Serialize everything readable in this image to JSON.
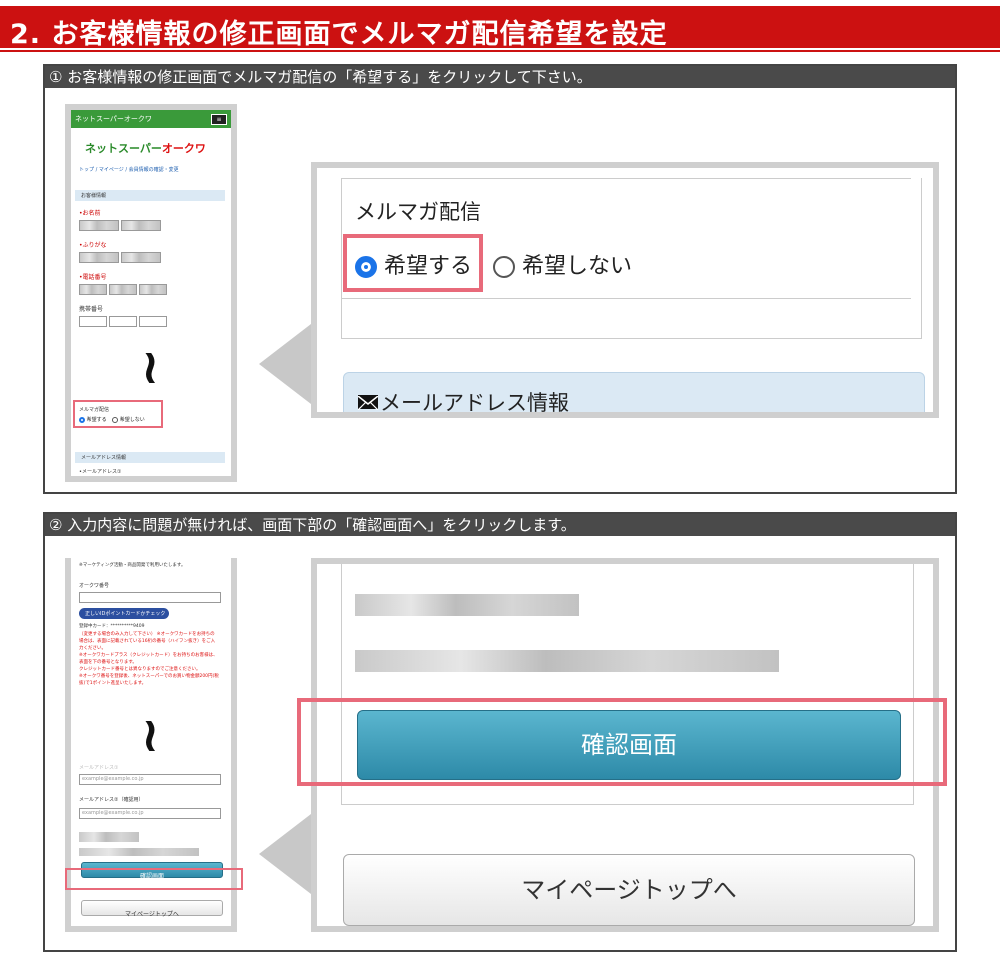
{
  "title": "2. お客様情報の修正画面でメルマガ配信希望を設定",
  "step1": {
    "instruction": "① お客様情報の修正画面でメルマガ配信の「希望する」をクリックして下さい。",
    "phone": {
      "header_title": "ネットスーパーオークワ",
      "logo_part1": "ネットスーパー",
      "logo_part2": "オークワ",
      "breadcrumb": "トップ / マイページ / 会員情報の確認・変更",
      "section_customer": "お客様情報",
      "label_name": "•お名前",
      "label_kana": "•ふりがな",
      "label_phone": "•電話番号",
      "label_mobile": "携帯番号",
      "label_mailmag": "メルマガ配信",
      "opt_yes": "希望する",
      "opt_no": "希望しない",
      "section_mail": "メールアドレス情報",
      "label_mail1": "•メールアドレス①",
      "squiggle": "~"
    },
    "zoom": {
      "label_mailmag": "メルマガ配信",
      "opt_yes": "希望する",
      "opt_no": "希望しない",
      "section_mail": "メールアドレス情報"
    }
  },
  "step2": {
    "instruction": "② 入力内容に問題が無ければ、画面下部の「確認画面へ」をクリックします。",
    "phone": {
      "top_note": "※マーケティング活動・商品開発で利用いたします。",
      "label_card": "オークワ番号",
      "card_button": "正しいIDポイントカードかチェック",
      "registered_card": "登録中カード：**********9409",
      "notes": [
        "（変更する場合のみ入力して下さい） ※オークワカードをお持ちの場合は、表面に記載されている16桁の番号（ハイフン抜き）をご入力ください。",
        "※オークワカードプラス（クレジットカード）をお持ちのお客様は、表面を下の番号となります。",
        "クレジットカード番号とは異なりますのでご注意ください。",
        "※オークワ番号を登録後、ネットスーパーでのお買い物金額200円(税抜)で1ポイント進呈いたします。"
      ],
      "label_mail1": "メールアドレス①",
      "mail_placeholder": "example@example.co.jp",
      "label_mail2": "メールアドレス②（確認用）",
      "confirm_button": "確認画面",
      "mypage_button": "マイページトップへ",
      "squiggle": "~"
    },
    "zoom": {
      "confirm_button": "確認画面",
      "mypage_button": "マイページトップへ"
    }
  },
  "colors": {
    "header_red": "#cc1111",
    "step_bar": "#4a4a4a",
    "highlight_pink": "#e86a7a",
    "phone_header_green": "#3a9a3a",
    "radio_blue": "#1a73e8",
    "button_blue": "#3a9ab8"
  }
}
